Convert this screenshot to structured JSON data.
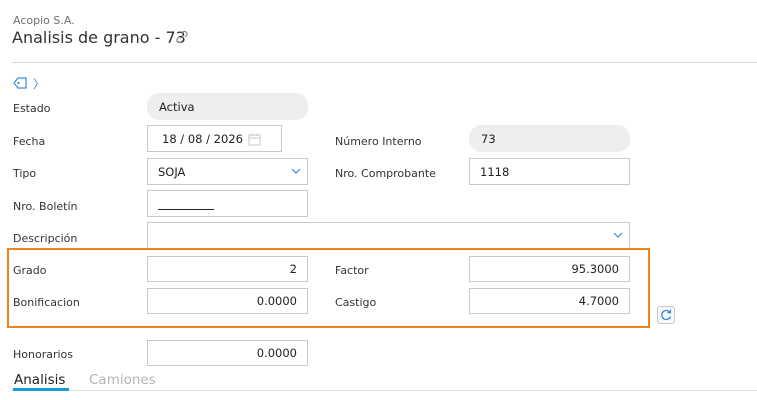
{
  "header": {
    "company": "Acopio S.A.",
    "title": "Analisis de grano - 73"
  },
  "form": {
    "estado": {
      "label": "Estado",
      "value": "Activa"
    },
    "fecha": {
      "label": "Fecha",
      "value": "18 / 08 / 2026"
    },
    "numero_interno": {
      "label": "Número Interno",
      "value": "73"
    },
    "tipo": {
      "label": "Tipo",
      "value": "SOJA"
    },
    "nro_comprobante": {
      "label": "Nro. Comprobante",
      "value": "1118"
    },
    "nro_boletin": {
      "label": "Nro. Boletín",
      "value": ""
    },
    "descripcion": {
      "label": "Descripción",
      "value": ""
    },
    "grado": {
      "label": "Grado",
      "value": "2"
    },
    "factor": {
      "label": "Factor",
      "value": "95.3000"
    },
    "bonificacion": {
      "label": "Bonificacion",
      "value": "0.0000"
    },
    "castigo": {
      "label": "Castigo",
      "value": "4.7000"
    },
    "honorarios": {
      "label": "Honorarios",
      "value": "0.0000"
    }
  },
  "tabs": [
    {
      "label": "Analisis",
      "active": true
    },
    {
      "label": "Camiones",
      "active": false
    }
  ],
  "colors": {
    "accent": "#1a9bd6",
    "highlight": "#f0821e",
    "pill_bg": "#eceeef"
  },
  "icons": [
    "link-icon",
    "tag-icon",
    "chevron-right-icon",
    "calendar-icon",
    "chevron-down-icon",
    "refresh-icon"
  ]
}
